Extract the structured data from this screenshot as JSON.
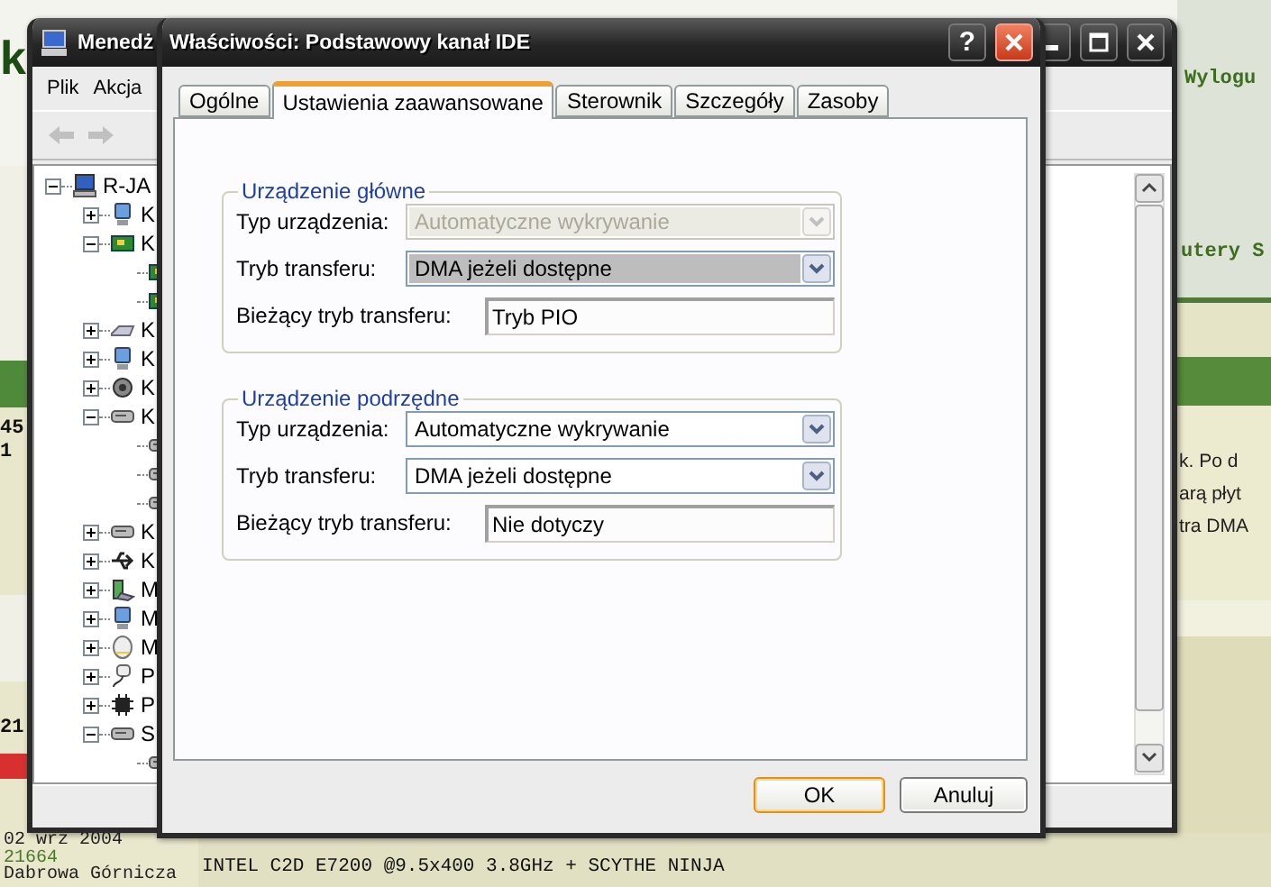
{
  "web_page": {
    "logo": "k",
    "left_numbers": [
      "45",
      "1",
      "21"
    ],
    "header_link": "Wylogu",
    "nav_text": "utery S",
    "post_lines": [
      "k. Po d",
      "arą płyt",
      "tra DMA"
    ],
    "profile_lines": [
      "02 wrz 2004",
      "21664",
      "Dabrowa Górnicza"
    ],
    "signature": "INTEL C2D E7200 @9.5x400 3.8GHz + SCYTHE NINJA"
  },
  "device_manager": {
    "title": "Menedż",
    "menu": [
      "Plik",
      "Akcja"
    ],
    "tree": {
      "label": "R-JA",
      "kind": "computer",
      "expanded": true,
      "children": [
        {
          "label": "K",
          "kind": "monitor",
          "expanded": false
        },
        {
          "label": "K",
          "kind": "board",
          "expanded": true,
          "children": [
            {
              "kind": "board"
            },
            {
              "kind": "board"
            }
          ]
        },
        {
          "label": "K",
          "kind": "keyboard",
          "expanded": false
        },
        {
          "label": "K",
          "kind": "monitor",
          "expanded": false
        },
        {
          "label": "K",
          "kind": "speaker",
          "expanded": false
        },
        {
          "label": "K",
          "kind": "drive",
          "expanded": true,
          "children": [
            {
              "kind": "drive"
            },
            {
              "kind": "drive"
            },
            {
              "kind": "drive"
            }
          ]
        },
        {
          "label": "K",
          "kind": "drive",
          "expanded": false
        },
        {
          "label": "K",
          "kind": "usb",
          "expanded": false
        },
        {
          "label": "M",
          "kind": "phone",
          "expanded": false
        },
        {
          "label": "M",
          "kind": "monitor",
          "expanded": false
        },
        {
          "label": "M",
          "kind": "mouse",
          "expanded": false
        },
        {
          "label": "P",
          "kind": "plug",
          "expanded": false
        },
        {
          "label": "P",
          "kind": "chip",
          "expanded": false
        },
        {
          "label": "S",
          "kind": "drive",
          "expanded": true,
          "children": [
            {
              "kind": "drive"
            }
          ]
        }
      ]
    }
  },
  "dialog": {
    "title": "Właściwości: Podstawowy kanał IDE",
    "help_button": "?",
    "tabs": [
      {
        "label": "Ogólne",
        "selected": false
      },
      {
        "label": "Ustawienia zaawansowane",
        "selected": true
      },
      {
        "label": "Sterownik",
        "selected": false
      },
      {
        "label": "Szczegóły",
        "selected": false
      },
      {
        "label": "Zasoby",
        "selected": false
      }
    ],
    "groups": [
      {
        "title": "Urządzenie główne",
        "rows": [
          {
            "kind": "combo",
            "label": "Typ urządzenia:",
            "value": "Automatyczne wykrywanie",
            "disabled": true,
            "focused": false
          },
          {
            "kind": "combo",
            "label": "Tryb transferu:",
            "value": "DMA jeżeli dostępne",
            "disabled": false,
            "focused": true
          },
          {
            "kind": "readonly",
            "label": "Bieżący tryb transferu:",
            "value": "Tryb PIO"
          }
        ]
      },
      {
        "title": "Urządzenie podrzędne",
        "rows": [
          {
            "kind": "combo",
            "label": "Typ urządzenia:",
            "value": "Automatyczne wykrywanie",
            "disabled": false,
            "focused": false
          },
          {
            "kind": "combo",
            "label": "Tryb transferu:",
            "value": "DMA jeżeli dostępne",
            "disabled": false,
            "focused": false
          },
          {
            "kind": "readonly",
            "label": "Bieżący tryb transferu:",
            "value": "Nie dotyczy"
          }
        ]
      }
    ],
    "buttons": [
      {
        "label": "OK",
        "default": true
      },
      {
        "label": "Anuluj",
        "default": false
      }
    ]
  }
}
